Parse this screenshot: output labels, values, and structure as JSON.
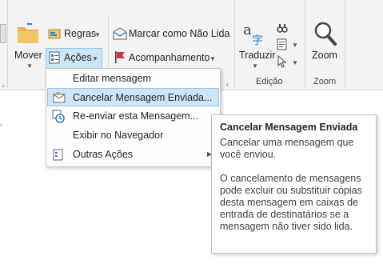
{
  "ribbon": {
    "mover_label": "Mover",
    "regras_label": "Regras",
    "acoes_label": "Ações",
    "marcar_label": "Marcar como Não Lida",
    "acompanhamento_label": "Acompanhamento",
    "traduzir_label": "Traduzir",
    "zoom_label": "Zoom",
    "group_edicao": "Edição",
    "group_zoom": "Zoom"
  },
  "menu": {
    "items": [
      {
        "label": "Editar mensagem"
      },
      {
        "label": "Cancelar Mensagem Enviada..."
      },
      {
        "label": "Re-enviar esta Mensagem..."
      },
      {
        "label": "Exibir no Navegador"
      },
      {
        "label": "Outras Ações"
      }
    ]
  },
  "tooltip": {
    "title": "Cancelar Mensagem Enviada",
    "para1": "Cancelar uma mensagem que você enviou.",
    "para2": "O cancelamento de mensagens pode excluir ou substituir cópias desta mensagem em caixas de entrada de destinatários se a mensagem não tiver sido lida."
  },
  "colors": {
    "accent": "#0078d4",
    "hover": "#cde6f7",
    "flag_red": "#d13438",
    "folder_yellow": "#e8b14a"
  }
}
